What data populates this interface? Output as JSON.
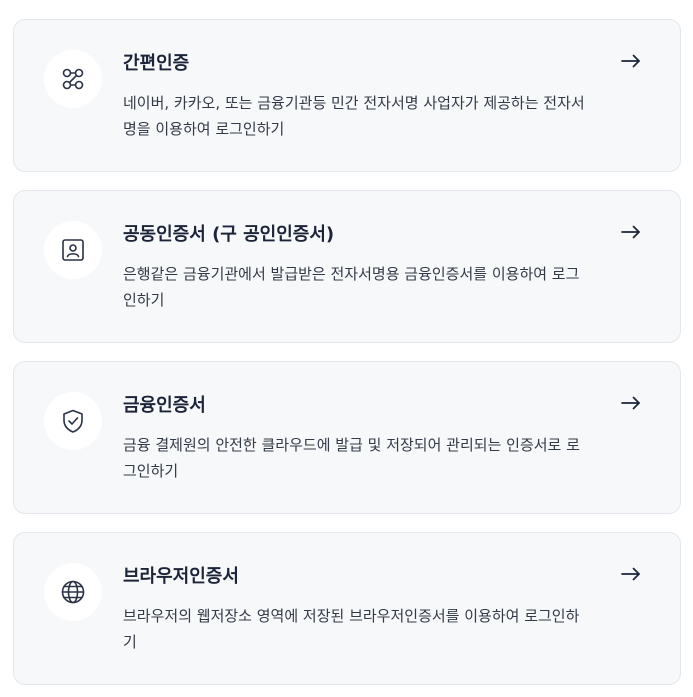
{
  "methods": [
    {
      "title": "간편인증",
      "desc": "네이버, 카카오, 또는 금융기관등 민간 전자서명 사업자가 제공하는 전자서명을 이용하여 로그인하기",
      "icon": "flow-icon"
    },
    {
      "title": "공동인증서 (구 공인인증서)",
      "desc": "은행같은 금융기관에서 발급받은 전자서명용 금융인증서를 이용하여 로그인하기",
      "icon": "id-card-icon"
    },
    {
      "title": "금융인증서",
      "desc": "금융 결제원의 안전한 클라우드에 발급 및 저장되어 관리되는 인증서로 로그인하기",
      "icon": "shield-check-icon"
    },
    {
      "title": "브라우저인증서",
      "desc": "브라우저의 웹저장소 영역에 저장된 브라우저인증서를 이용하여 로그인하기",
      "icon": "globe-icon"
    }
  ],
  "arrow_icon": "arrow-right-icon",
  "colors": {
    "card_background": "#f7f8fa",
    "card_border": "#e3e6eb",
    "text_primary": "#1b2438"
  }
}
